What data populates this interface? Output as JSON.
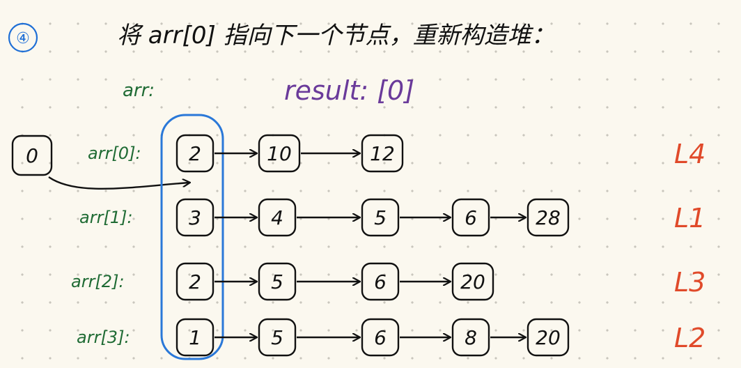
{
  "step": "④",
  "title": "将 arr[0] 指向下一个节点，重新构造堆：",
  "arr_label": "arr:",
  "result_label": "result: [0]",
  "result_node": "0",
  "rows": [
    {
      "label": "arr[0]:",
      "nodes": [
        "2",
        "10",
        "12"
      ],
      "tag": "L4"
    },
    {
      "label": "arr[1]:",
      "nodes": [
        "3",
        "4",
        "5",
        "6",
        "28"
      ],
      "tag": "L1"
    },
    {
      "label": "arr[2]:",
      "nodes": [
        "2",
        "5",
        "6",
        "20"
      ],
      "tag": "L3"
    },
    {
      "label": "arr[3]:",
      "nodes": [
        "1",
        "5",
        "6",
        "8",
        "20"
      ],
      "tag": "L2"
    }
  ],
  "colors": {
    "ink": "#111111",
    "step": "#1f6fd6",
    "label": "#1f6b34",
    "result": "#6a3a9a",
    "tag": "#e04a2a",
    "highlight": "#2a78d8"
  }
}
